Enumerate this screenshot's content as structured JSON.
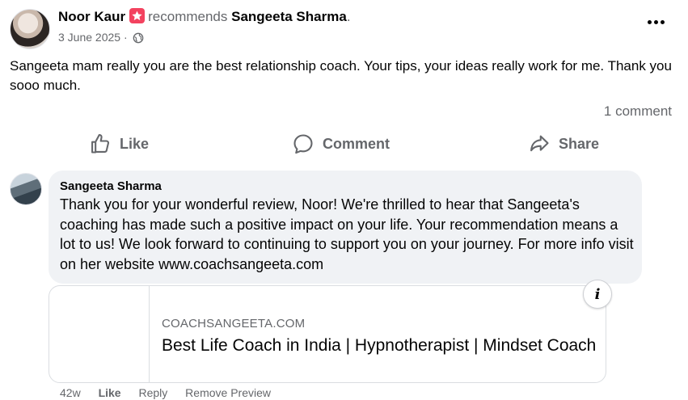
{
  "post": {
    "author": "Noor Kaur",
    "action": "recommends",
    "page": "Sangeeta Sharma",
    "page_suffix": ".",
    "date": "3 June 2025 ·",
    "text": "Sangeeta mam really you are the best relationship coach. Your tips, your ideas really work for me. Thank you sooo much.",
    "comment_count": "1 comment"
  },
  "actions": {
    "like": "Like",
    "comment": "Comment",
    "share": "Share"
  },
  "comment": {
    "author": "Sangeeta Sharma",
    "text": "Thank you for your wonderful review, Noor! We're thrilled to hear that Sangeeta's coaching has made such a positive impact on your life. Your recommendation means a lot to us! We look forward to continuing to support you on your journey. For more info visit on her website www.coachsangeeta.com",
    "link_preview": {
      "domain": "COACHSANGEETA.COM",
      "title": "Best Life Coach in India | Hypnotherapist | Mindset Coach",
      "info_icon": "i"
    },
    "meta": {
      "age": "42w",
      "like": "Like",
      "reply": "Reply",
      "remove_preview": "Remove Preview"
    }
  },
  "icons": {
    "recommend_badge": "star-icon",
    "privacy": "globe-icon",
    "more": "more-options-icon",
    "like": "thumbs-up-icon",
    "comment": "comment-bubble-icon",
    "share": "share-arrow-icon"
  },
  "colors": {
    "badge": "#f3425f",
    "secondary_text": "#65676b",
    "bubble": "#f0f2f5"
  }
}
